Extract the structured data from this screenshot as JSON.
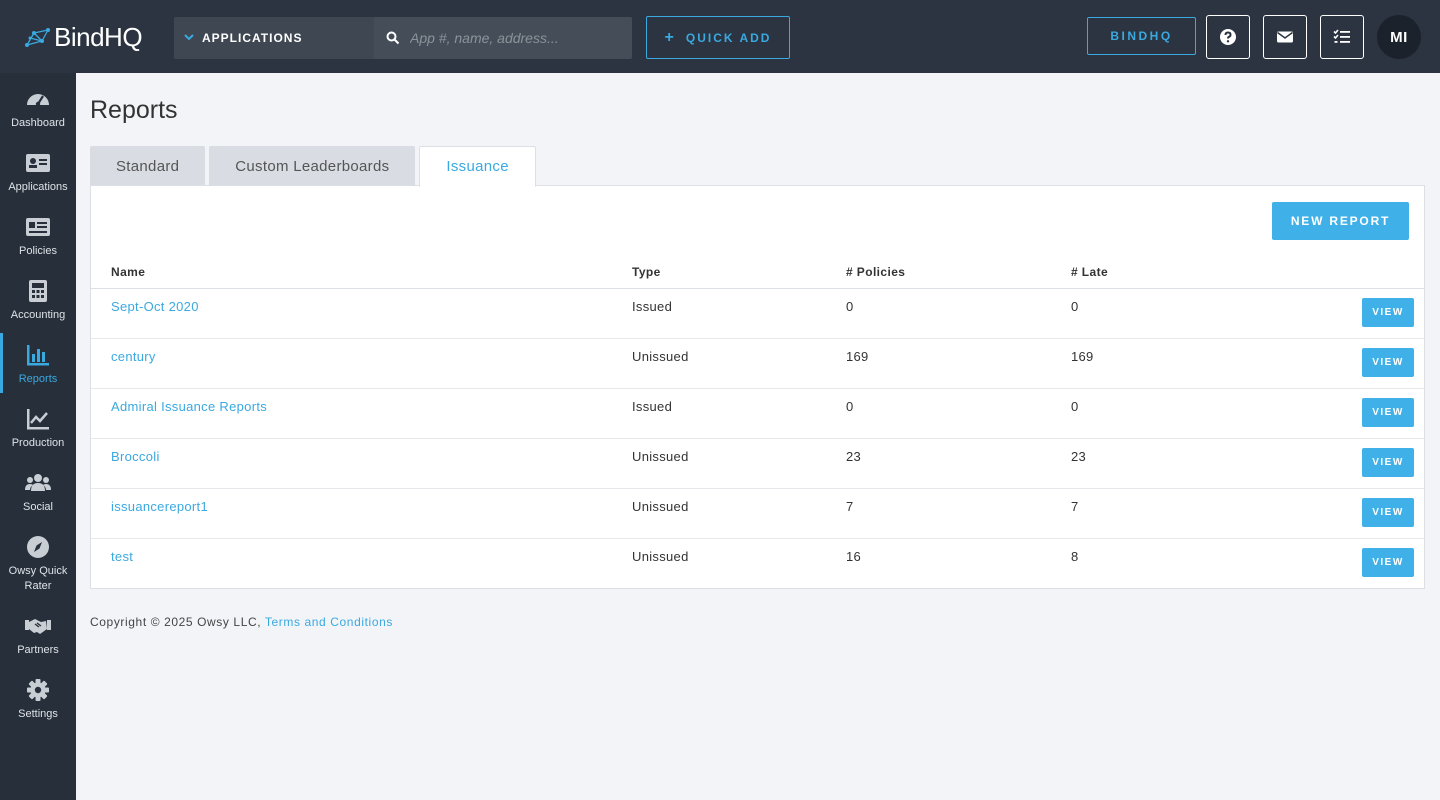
{
  "header": {
    "logo_text": "BindHQ",
    "scope_label": "APPLICATIONS",
    "search_placeholder": "App #, name, address...",
    "quick_add_label": "QUICK ADD",
    "org_button_label": "BINDHQ",
    "avatar_initials": "MI"
  },
  "sidebar": {
    "items": [
      {
        "label": "Dashboard",
        "icon": "dashboard-icon"
      },
      {
        "label": "Applications",
        "icon": "applications-icon"
      },
      {
        "label": "Policies",
        "icon": "policies-icon"
      },
      {
        "label": "Accounting",
        "icon": "calculator-icon"
      },
      {
        "label": "Reports",
        "icon": "bar-chart-icon",
        "active": true
      },
      {
        "label": "Production",
        "icon": "line-chart-icon"
      },
      {
        "label": "Social",
        "icon": "users-icon"
      },
      {
        "label": "Owsy Quick Rater",
        "icon": "compass-icon"
      },
      {
        "label": "Partners",
        "icon": "handshake-icon"
      },
      {
        "label": "Settings",
        "icon": "gear-icon"
      }
    ]
  },
  "main": {
    "title": "Reports",
    "tabs": [
      {
        "label": "Standard"
      },
      {
        "label": "Custom Leaderboards"
      },
      {
        "label": "Issuance",
        "active": true
      }
    ],
    "new_report_label": "NEW REPORT",
    "table": {
      "columns": [
        "Name",
        "Type",
        "# Policies",
        "# Late"
      ],
      "view_label": "VIEW",
      "rows": [
        {
          "name": "Sept-Oct 2020",
          "type": "Issued",
          "policies": "0",
          "late": "0"
        },
        {
          "name": "century",
          "type": "Unissued",
          "policies": "169",
          "late": "169"
        },
        {
          "name": "Admiral Issuance Reports",
          "type": "Issued",
          "policies": "0",
          "late": "0"
        },
        {
          "name": "Broccoli",
          "type": "Unissued",
          "policies": "23",
          "late": "23"
        },
        {
          "name": "issuancereport1",
          "type": "Unissued",
          "policies": "7",
          "late": "7"
        },
        {
          "name": "test",
          "type": "Unissued",
          "policies": "16",
          "late": "8"
        }
      ]
    }
  },
  "footer": {
    "copyright": "Copyright © 2025 Owsy LLC, ",
    "terms_link": "Terms and Conditions"
  },
  "colors": {
    "accent": "#3aa9e0",
    "topbar": "#2b3440",
    "sidebar": "#262f3a"
  }
}
